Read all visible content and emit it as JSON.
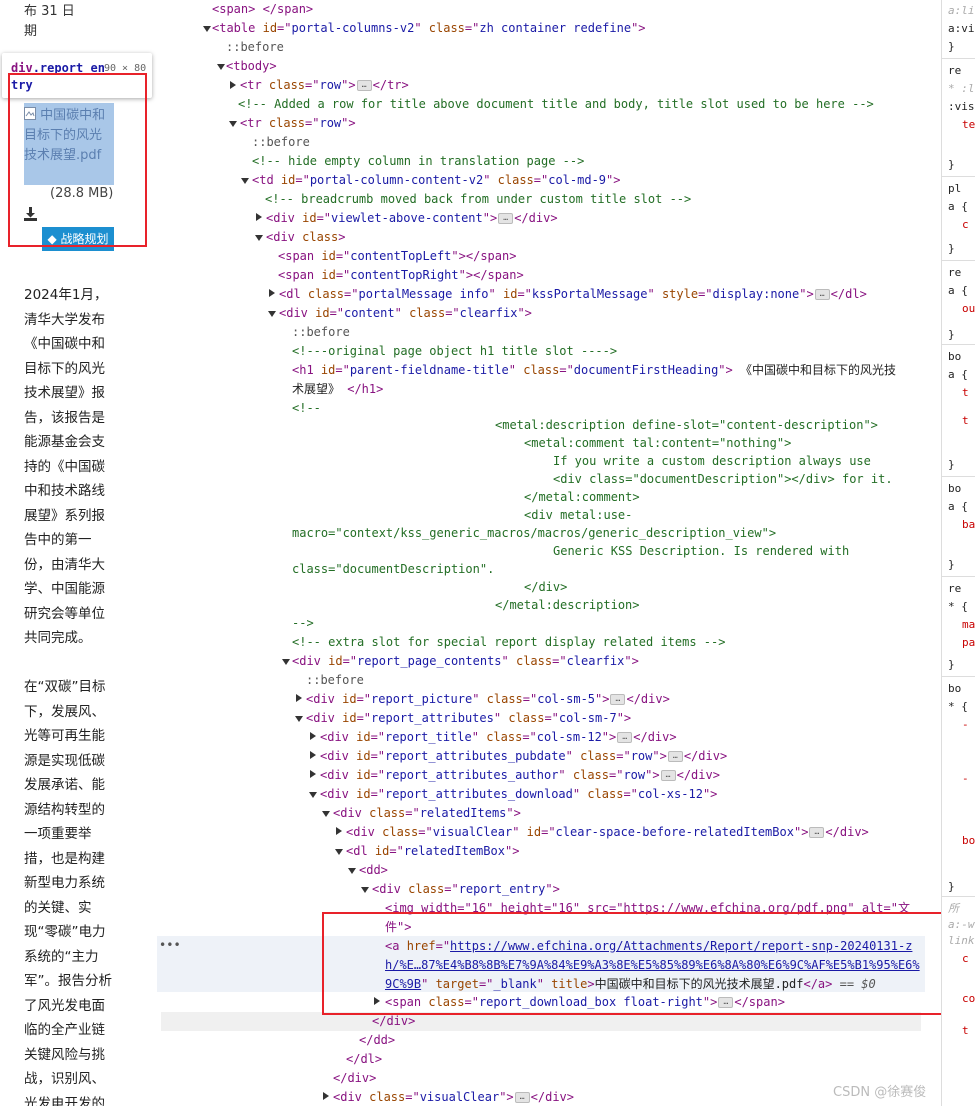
{
  "page_preview": {
    "top_text": "布 31 日 期",
    "tooltip_selector_tag": "div",
    "tooltip_selector_class": ".report_en try",
    "tooltip_dims": "90 × 80",
    "pdf_link": "中国碳中和目标下的风光技术展望.pdf",
    "pdf_size": "(28.8 MB)",
    "download_icon": "download-icon",
    "tag_label": "战略规划",
    "paragraph1": "2024年1月，清华大学发布《中国碳中和目标下的风光技术展望》报告，该报告是能源基金会支持的《中国碳中和技术路线展望》系列报告中的第一份，由清华大学、中国能源研究会等单位共同完成。",
    "paragraph2": "在“双碳”目标下，发展风、光等可再生能源是实现低碳发展承诺、能源结构转型的一项重要举措，也是构建新型电力系统的关键、实现“零碳”电力系统的“主力军”。报告分析了风光发电面临的全产业链关键风险与挑战，识别风、光发电开发的",
    "accent_color": "#1c8fd0",
    "highlight_color": "#e8222a"
  },
  "code": {
    "l1": "<span> </span>",
    "l2_tag": "table",
    "l2_id": "portal-columns-v2",
    "l2_class": "zh container redefine",
    "before": "::before",
    "tbody": "tbody",
    "tr_row": "row",
    "comment1": "<!-- Added a row for title above document title and body, title slot used to be here -->",
    "comment2": "<!-- hide empty column in translation page -->",
    "td_id": "portal-column-content-v2",
    "td_class": "col-md-9",
    "comment3": "<!-- breadcrumb moved back from under custom title slot -->",
    "viewlet_id": "viewlet-above-content",
    "span1": "contentTopLeft",
    "span2": "contentTopRight",
    "dl_class": "portalMessage info",
    "dl_id": "kssPortalMessage",
    "dl_style": "display:none",
    "content_id": "content",
    "content_class": "clearfix",
    "comment4": "<!---original page object h1 title slot ---->",
    "h1_id": "parent-fieldname-title",
    "h1_class": "documentFirstHeading",
    "h1_text_1": " 《中国碳中和目标下的风光技",
    "h1_text_2": "术展望》 ",
    "open_comment": "<!--",
    "meta1": "<metal:description define-slot=\"content-description\">",
    "meta2": "<metal:comment tal:content=\"nothing\">",
    "meta3": "If you write a custom description always use",
    "meta4": "<div class=\"documentDescription\"></div> for it.",
    "meta5": "</metal:comment>",
    "meta6": "<div metal:use-",
    "meta7": "macro=\"context/kss_generic_macros/macros/generic_description_view\">",
    "meta8": "Generic KSS Description. Is rendered with",
    "meta9": "class=\"documentDescription\".",
    "meta10": "</div>",
    "meta11": "</metal:description>",
    "close_comment": "-->",
    "comment5": "<!-- extra slot for special report display related items -->",
    "rpc_id": "report_page_contents",
    "rpc_class": "clearfix",
    "rp_id": "report_picture",
    "rp_class": "col-sm-5",
    "ra_id": "report_attributes",
    "ra_class": "col-sm-7",
    "rt_id": "report_title",
    "rt_class": "col-sm-12",
    "rap_id": "report_attributes_pubdate",
    "rap_class": "row",
    "raa_id": "report_attributes_author",
    "raa_class": "row",
    "rad_id": "report_attributes_download",
    "rad_class": "col-xs-12",
    "ri_class": "relatedItems",
    "vc_class": "visualClear",
    "vc_id": "clear-space-before-relatedItemBox",
    "rib_id": "relatedItemBox",
    "re_class": "report_entry",
    "img_line": "<img width=\"16\" height=\"16\" src=\"https://www.efchina.org/pdf.png\" alt=\"文",
    "img_line2": "件\">",
    "a_href_1": "https://www.efchina.org/Attachments/Report/report-snp-20240131-z",
    "a_href_2": "h/%E…87%E4%B8%8B%E7%9A%84%E9%A3%8E%E5%85%89%E6%8A%80%E6%9C%AF%E5%B1%95%E6%",
    "a_href_3": "9C%9B",
    "a_target": "_blank",
    "a_text": "中国碳中和目标下的风光技术展望.pdf",
    "a_eq": "== $0",
    "rdb_class": "report_download_box float-right",
    "close_div": "</div>",
    "close_dd": "</dd>",
    "close_dl": "</dl>",
    "vc2_class": "visualClear"
  },
  "styles": {
    "items": [
      "a:li",
      "a:vi",
      "}",
      "re",
      "* :l",
      ":vis",
      "te",
      "}",
      "pl",
      "a {",
      "c",
      "}",
      "re",
      "a {",
      "ou",
      "}",
      "bo",
      "a {",
      "t",
      "t",
      "}",
      "bo",
      "a {",
      "ba",
      "}",
      "re",
      "* {",
      "ma",
      "pa",
      "}",
      "bo",
      "* {",
      "-",
      "-",
      "bo",
      "}",
      "所",
      "a:-w",
      "link",
      "c",
      "co",
      "t"
    ]
  },
  "watermark": "CSDN @徐赛俊"
}
